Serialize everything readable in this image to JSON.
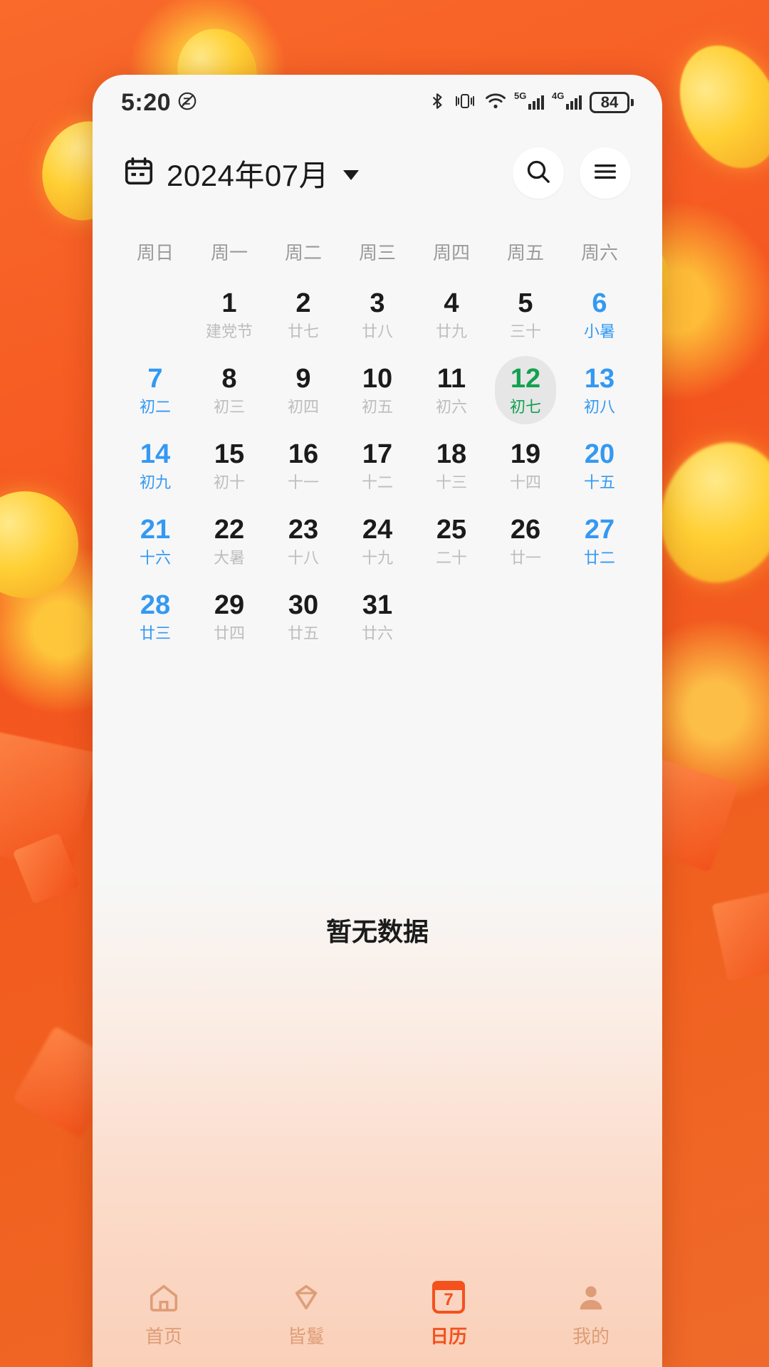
{
  "status_bar": {
    "time": "5:20",
    "icons": [
      "dnd-icon",
      "bluetooth-icon",
      "vibrate-icon",
      "wifi-icon",
      "signal-5g-icon",
      "signal-4g-icon"
    ],
    "network_5g_label": "5G",
    "network_4g_label": "4G",
    "battery_level": "84"
  },
  "header": {
    "calendar_icon": "calendar-icon",
    "month_title": "2024年07月",
    "dropdown_icon": "chevron-down-icon",
    "search_icon": "search-icon",
    "menu_icon": "hamburger-menu-icon"
  },
  "calendar": {
    "weekdays": [
      "周日",
      "周一",
      "周二",
      "周三",
      "周四",
      "周五",
      "周六"
    ],
    "weeks": [
      [
        {
          "day": "",
          "lunar": "",
          "style": "empty"
        },
        {
          "day": "1",
          "lunar": "建党节",
          "style": "normal"
        },
        {
          "day": "2",
          "lunar": "廿七",
          "style": "normal"
        },
        {
          "day": "3",
          "lunar": "廿八",
          "style": "normal"
        },
        {
          "day": "4",
          "lunar": "廿九",
          "style": "normal"
        },
        {
          "day": "5",
          "lunar": "三十",
          "style": "normal"
        },
        {
          "day": "6",
          "lunar": "小暑",
          "style": "blue"
        }
      ],
      [
        {
          "day": "7",
          "lunar": "初二",
          "style": "blue"
        },
        {
          "day": "8",
          "lunar": "初三",
          "style": "normal"
        },
        {
          "day": "9",
          "lunar": "初四",
          "style": "normal"
        },
        {
          "day": "10",
          "lunar": "初五",
          "style": "normal"
        },
        {
          "day": "11",
          "lunar": "初六",
          "style": "normal"
        },
        {
          "day": "12",
          "lunar": "初七",
          "style": "today"
        },
        {
          "day": "13",
          "lunar": "初八",
          "style": "blue"
        }
      ],
      [
        {
          "day": "14",
          "lunar": "初九",
          "style": "blue"
        },
        {
          "day": "15",
          "lunar": "初十",
          "style": "normal"
        },
        {
          "day": "16",
          "lunar": "十一",
          "style": "normal"
        },
        {
          "day": "17",
          "lunar": "十二",
          "style": "normal"
        },
        {
          "day": "18",
          "lunar": "十三",
          "style": "normal"
        },
        {
          "day": "19",
          "lunar": "十四",
          "style": "normal"
        },
        {
          "day": "20",
          "lunar": "十五",
          "style": "blue"
        }
      ],
      [
        {
          "day": "21",
          "lunar": "十六",
          "style": "blue"
        },
        {
          "day": "22",
          "lunar": "大暑",
          "style": "normal"
        },
        {
          "day": "23",
          "lunar": "十八",
          "style": "normal"
        },
        {
          "day": "24",
          "lunar": "十九",
          "style": "normal"
        },
        {
          "day": "25",
          "lunar": "二十",
          "style": "normal"
        },
        {
          "day": "26",
          "lunar": "廿一",
          "style": "normal"
        },
        {
          "day": "27",
          "lunar": "廿二",
          "style": "blue"
        }
      ],
      [
        {
          "day": "28",
          "lunar": "廿三",
          "style": "blue"
        },
        {
          "day": "29",
          "lunar": "廿四",
          "style": "normal"
        },
        {
          "day": "30",
          "lunar": "廿五",
          "style": "normal"
        },
        {
          "day": "31",
          "lunar": "廿六",
          "style": "normal"
        },
        {
          "day": "",
          "lunar": "",
          "style": "empty"
        },
        {
          "day": "",
          "lunar": "",
          "style": "empty"
        },
        {
          "day": "",
          "lunar": "",
          "style": "empty"
        }
      ]
    ]
  },
  "content": {
    "empty_text": "暂无数据"
  },
  "tabbar": {
    "items": [
      {
        "label": "首页",
        "icon": "home-icon",
        "active": false
      },
      {
        "label": "皆鬘",
        "icon": "gem-icon",
        "active": false
      },
      {
        "label": "日历",
        "icon": "calendar-badge-icon",
        "active": true,
        "badge": "7"
      },
      {
        "label": "我的",
        "icon": "person-icon",
        "active": false
      }
    ]
  },
  "colors": {
    "brand_orange": "#F4511E",
    "weekend_blue": "#3399F3",
    "today_green": "#12A150",
    "background_orange": "#F4622A"
  }
}
